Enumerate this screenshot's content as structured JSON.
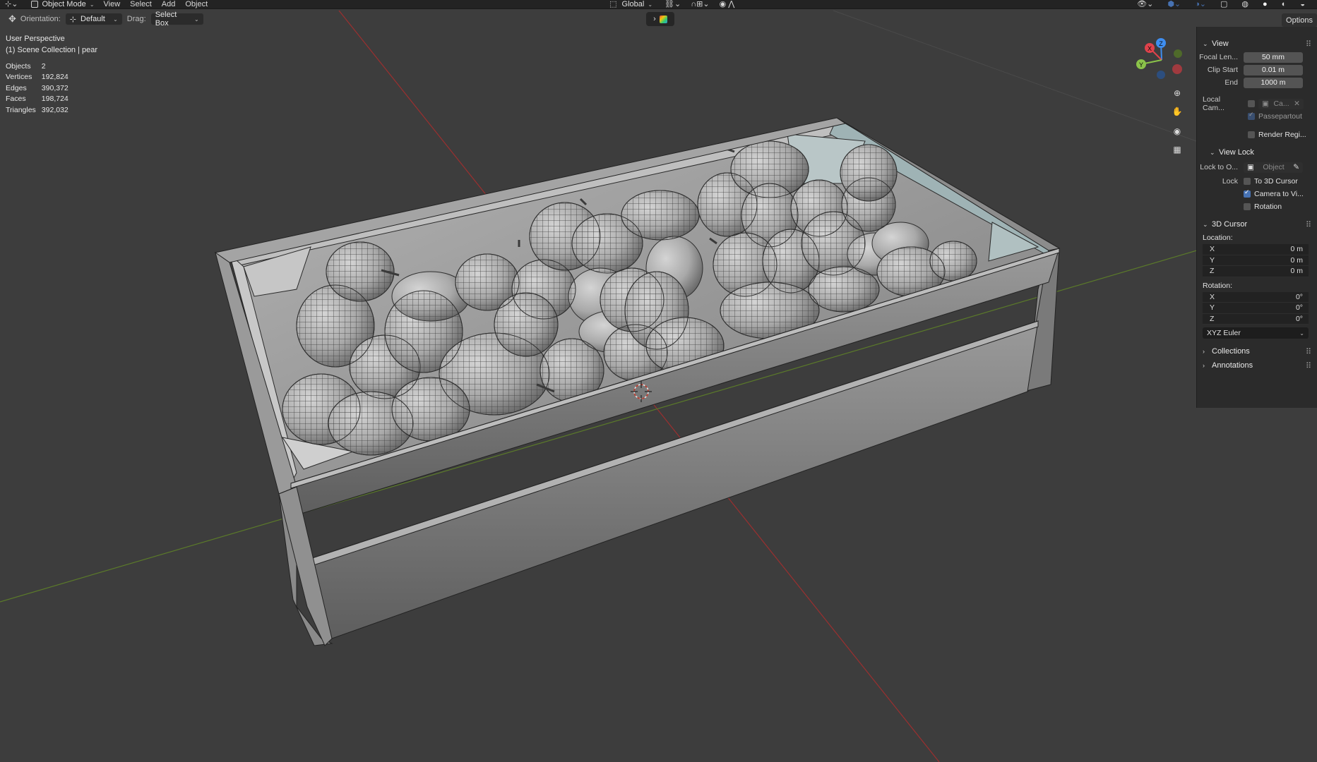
{
  "header": {
    "mode": "Object Mode",
    "menu": [
      "View",
      "Select",
      "Add",
      "Object"
    ],
    "transform_orientation": "Global"
  },
  "tool_settings": {
    "orientation_label": "Orientation:",
    "orientation_value": "Default",
    "drag_label": "Drag:",
    "drag_value": "Select Box"
  },
  "options_tab": "Options",
  "overlay": {
    "perspective": "User Perspective",
    "collection": "(1) Scene Collection | pear",
    "stats": [
      {
        "label": "Objects",
        "value": "2"
      },
      {
        "label": "Vertices",
        "value": "192,824"
      },
      {
        "label": "Edges",
        "value": "390,372"
      },
      {
        "label": "Faces",
        "value": "198,724"
      },
      {
        "label": "Triangles",
        "value": "392,032"
      }
    ]
  },
  "gizmo": {
    "x": "X",
    "y": "Y",
    "z": "Z"
  },
  "npanel": {
    "view": {
      "title": "View",
      "focal_label": "Focal Len...",
      "focal_value": "50 mm",
      "clip_start_label": "Clip Start",
      "clip_start_value": "0.01 m",
      "end_label": "End",
      "end_value": "1000 m",
      "local_camera_label": "Local Cam...",
      "local_camera_value": "Ca...",
      "passepartout": "Passepartout",
      "render_region": "Render Regi..."
    },
    "view_lock": {
      "title": "View Lock",
      "lock_to_label": "Lock to O...",
      "lock_to_placeholder": "Object",
      "lock_label": "Lock",
      "to_cursor": "To 3D Cursor",
      "camera_to_view": "Camera to Vi...",
      "rotation": "Rotation",
      "to_cursor_checked": false,
      "camera_to_view_checked": true,
      "rotation_checked": false
    },
    "cursor": {
      "title": "3D Cursor",
      "location_label": "Location:",
      "loc": [
        {
          "axis": "X",
          "value": "0 m"
        },
        {
          "axis": "Y",
          "value": "0 m"
        },
        {
          "axis": "Z",
          "value": "0 m"
        }
      ],
      "rotation_label": "Rotation:",
      "rot": [
        {
          "axis": "X",
          "value": "0°"
        },
        {
          "axis": "Y",
          "value": "0°"
        },
        {
          "axis": "Z",
          "value": "0°"
        }
      ],
      "rotation_mode": "XYZ Euler"
    },
    "collections": "Collections",
    "annotations": "Annotations"
  },
  "colors": {
    "background": "#3d3d3d",
    "x_axis": "#9c2f2f",
    "y_axis": "#5b7a2a",
    "gizmo_x": "#e0424b",
    "gizmo_y": "#8bc34a",
    "gizmo_z": "#3f8ef0",
    "accent": "#4772b3"
  }
}
